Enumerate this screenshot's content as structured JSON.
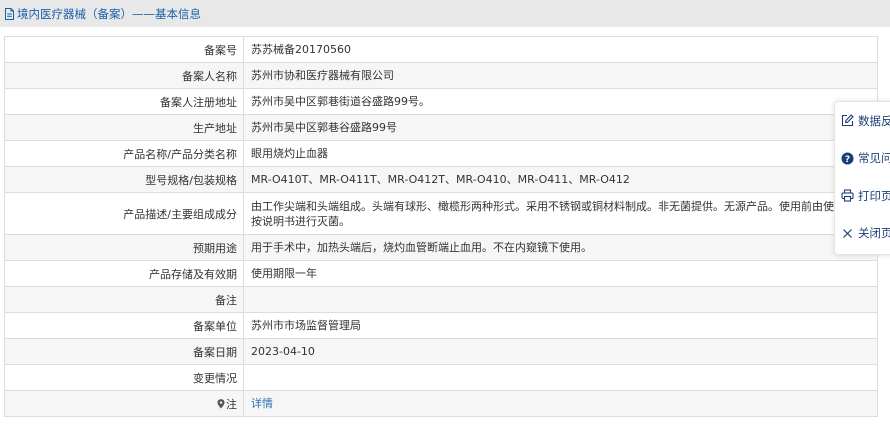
{
  "header": {
    "title": "境内医疗器械（备案）——基本信息"
  },
  "rows": [
    {
      "label": "备案号",
      "value": "苏苏械备20170560"
    },
    {
      "label": "备案人名称",
      "value": "苏州市协和医疗器械有限公司"
    },
    {
      "label": "备案人注册地址",
      "value": "苏州市吴中区郭巷街道谷盛路99号。"
    },
    {
      "label": "生产地址",
      "value": "苏州市吴中区郭巷谷盛路99号"
    },
    {
      "label": "产品名称/产品分类名称",
      "value": "眼用烧灼止血器"
    },
    {
      "label": "型号规格/包装规格",
      "value": "MR-O410T、MR-O411T、MR-O412T、MR-O410、MR-O411、MR-O412"
    },
    {
      "label": "产品描述/主要组成成分",
      "value": "由工作尖端和头端组成。头端有球形、橄榄形两种形式。采用不锈钢或铜材料制成。非无菌提供。无源产品。使用前由使用机构按说明书进行灭菌。"
    },
    {
      "label": "预期用途",
      "value": "用于手术中，加热头端后，烧灼血管断端止血用。不在内窥镜下使用。"
    },
    {
      "label": "产品存储及有效期",
      "value": "使用期限一年"
    },
    {
      "label": "备注",
      "value": ""
    },
    {
      "label": "备案单位",
      "value": "苏州市市场监督管理局"
    },
    {
      "label": "备案日期",
      "value": "2023-04-10"
    },
    {
      "label": "变更情况",
      "value": ""
    },
    {
      "label": "注",
      "value": "详情"
    }
  ],
  "float_panel": {
    "items": [
      {
        "label": "数据反馈",
        "icon": "edit-icon"
      },
      {
        "label": "常见问题",
        "icon": "question-icon"
      },
      {
        "label": "打印页面",
        "icon": "print-icon"
      },
      {
        "label": "关闭页面",
        "icon": "close-icon"
      }
    ]
  },
  "colors": {
    "header_text": "#1a5faa",
    "link": "#2f6fb5",
    "panel_text": "#1c3e78"
  }
}
